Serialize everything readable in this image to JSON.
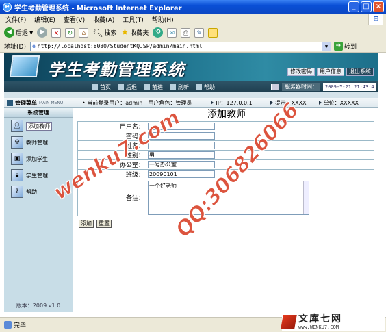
{
  "window": {
    "title": "学生考勤管理系统 - Microsoft Internet Explorer",
    "icon": "ie-icon"
  },
  "menubar": {
    "items": [
      "文件(F)",
      "编辑(E)",
      "查看(V)",
      "收藏(A)",
      "工具(T)",
      "帮助(H)"
    ]
  },
  "toolbar": {
    "back": "后退",
    "search": "搜索",
    "favorites": "收藏夹"
  },
  "addressbar": {
    "label": "地址(D)",
    "url": "http://localhost:8080/StudentKQJSP/admin/main.html",
    "go": "转到"
  },
  "banner": {
    "title": "学生考勤管理系统",
    "buttons": [
      "修改密码",
      "用户信息",
      "退出系统"
    ]
  },
  "nav": {
    "links": [
      "首页",
      "后退",
      "前进",
      "刷新",
      "帮助"
    ],
    "server_time_label": "服务器时间：",
    "server_time": "2009-5-21 21:43:4"
  },
  "infobar": {
    "menu_label": "管理菜单",
    "menu_en": "MAIN MENU",
    "current_user": "当前登录用户：admin",
    "role": "用户角色：管理员",
    "ip": "IP：127.0.0.1",
    "hint": "提示：XXXX",
    "unit": "单位：XXXXX"
  },
  "sidebar": {
    "header": "系统管理",
    "items": [
      "添加教师",
      "教师管理",
      "添加学生",
      "学生管理",
      "帮助"
    ],
    "version": "版本：2009 v1.0"
  },
  "form": {
    "title": "添加教师",
    "fields": [
      {
        "label": "用户名：",
        "value": ""
      },
      {
        "label": "密码：",
        "value": ""
      },
      {
        "label": "姓名：",
        "value": ""
      },
      {
        "label": "性别：",
        "value": "男"
      },
      {
        "label": "办公室：",
        "value": "一号办公室"
      },
      {
        "label": "班级：",
        "value": "20090101"
      }
    ],
    "remark_label": "备注：",
    "remark_value": "一个好老师",
    "submit": "添加",
    "reset": "重置"
  },
  "status": {
    "text": "完毕"
  },
  "watermarks": {
    "left": "wenku7.com",
    "right": "QQ:306826066"
  },
  "logo": {
    "name": "文库七网",
    "url": "www.WENKU7.COM"
  }
}
